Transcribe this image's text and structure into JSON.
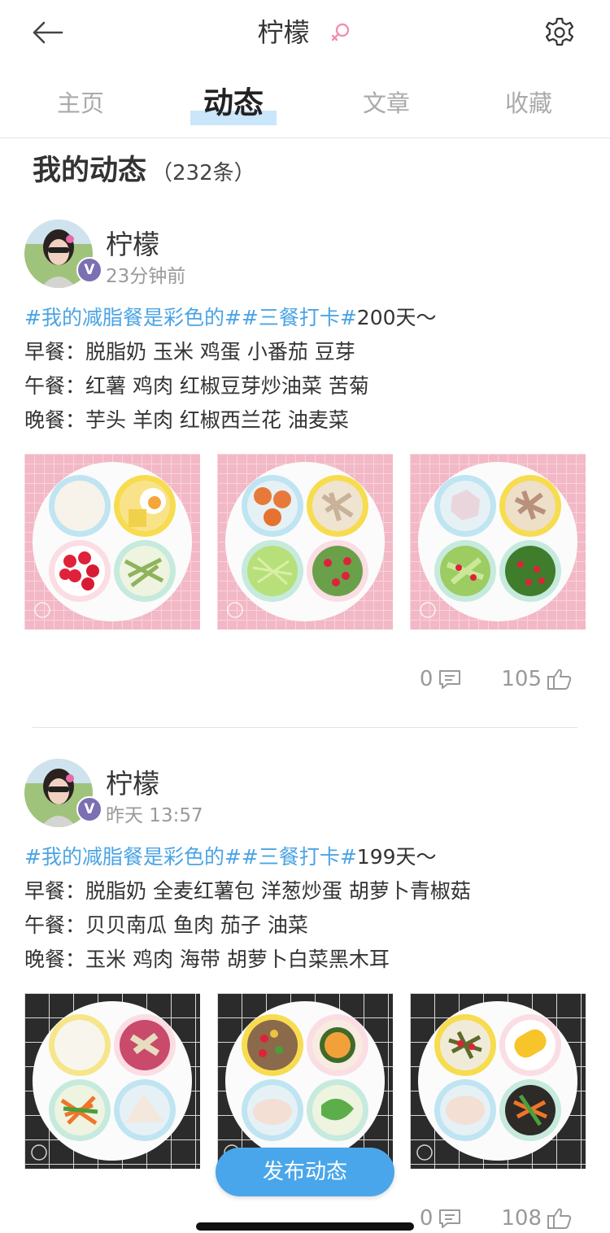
{
  "header": {
    "title": "柠檬",
    "back_icon": "arrow-left-icon",
    "gender_icon": "female-symbol-icon",
    "settings_icon": "gear-icon"
  },
  "tabs": [
    {
      "label": "主页",
      "active": false
    },
    {
      "label": "动态",
      "active": true
    },
    {
      "label": "文章",
      "active": false
    },
    {
      "label": "收藏",
      "active": false
    }
  ],
  "section": {
    "title": "我的动态",
    "count": "（232条）"
  },
  "posts": [
    {
      "user": "柠檬",
      "badge": "V",
      "time": "23分钟前",
      "hashtags": "#我的减脂餐是彩色的##三餐打卡#",
      "headline_rest": "200天～",
      "lines": [
        "早餐：脱脂奶 玉米 鸡蛋 小番茄 豆芽",
        "午餐：红薯 鸡肉 红椒豆芽炒油菜 苦菊",
        "晚餐：芋头 羊肉 红椒西兰花 油麦菜"
      ],
      "comments": "0",
      "likes": "105"
    },
    {
      "user": "柠檬",
      "badge": "V",
      "time": "昨天 13:57",
      "hashtags": "#我的减脂餐是彩色的##三餐打卡#",
      "headline_rest": "199天～",
      "lines": [
        "早餐：脱脂奶 全麦红薯包 洋葱炒蛋 胡萝卜青椒菇",
        "午餐：贝贝南瓜 鱼肉 茄子 油菜",
        "晚餐：玉米 鸡肉 海带 胡萝卜白菜黑木耳"
      ],
      "comments": "0",
      "likes": "108"
    }
  ],
  "publish_button": "发布动态",
  "colors": {
    "accent": "#4aa6ea",
    "hashtag": "#4ba4e4",
    "badge": "#7c6fb4",
    "tab_highlight": "#c9e6fa",
    "gender": "#f08fb5"
  }
}
